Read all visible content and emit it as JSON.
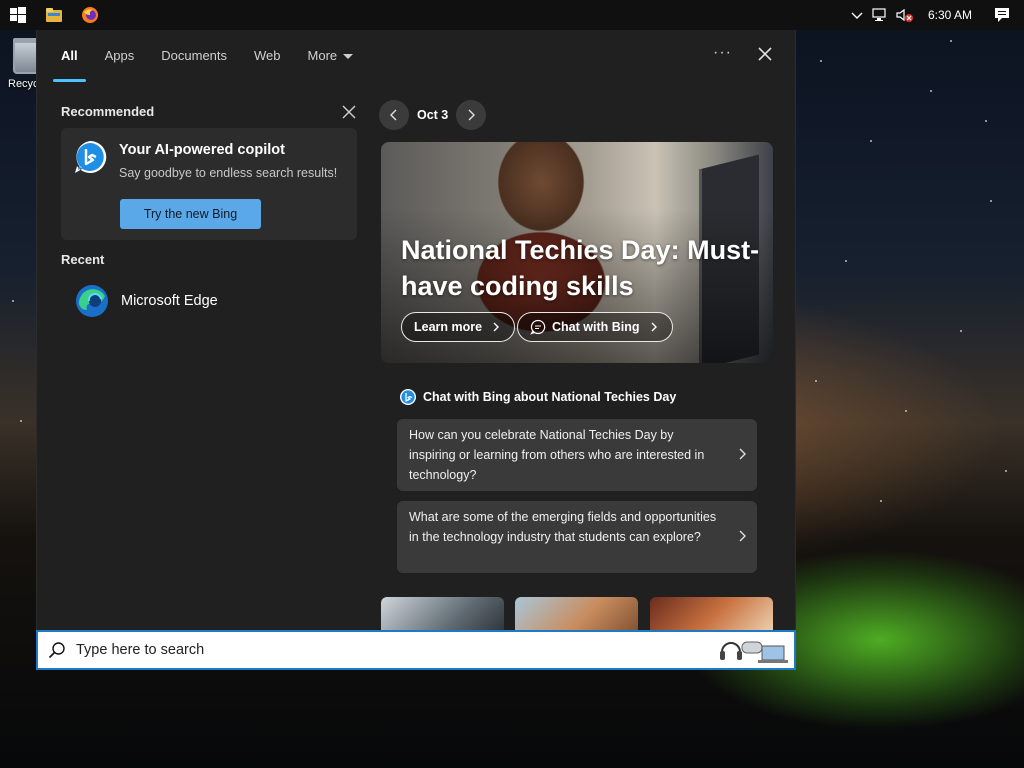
{
  "desktop": {
    "recycle_bin_label": "Recycle Bin"
  },
  "taskbar": {
    "clock": "6:30 AM",
    "icons": [
      "start-icon",
      "file-explorer-icon",
      "firefox-icon"
    ],
    "tray_icons": [
      "chevron-up-icon",
      "network-icon",
      "volume-muted-icon",
      "action-center-icon"
    ]
  },
  "search_panel": {
    "tabs": [
      {
        "label": "All",
        "active": true
      },
      {
        "label": "Apps"
      },
      {
        "label": "Documents"
      },
      {
        "label": "Web"
      },
      {
        "label": "More"
      }
    ],
    "more_options": "···",
    "recommended": {
      "title": "Recommended",
      "card": {
        "title": "Your AI-powered copilot",
        "subtitle": "Say goodbye to endless search results!",
        "button": "Try the new Bing"
      }
    },
    "recent": {
      "title": "Recent",
      "items": [
        {
          "label": "Microsoft Edge",
          "icon": "edge-icon"
        }
      ]
    },
    "highlights": {
      "date": "Oct 3",
      "hero": {
        "headline": "National Techies Day: Must-have coding skills",
        "learn_more": "Learn more",
        "chat_with_bing": "Chat with Bing"
      },
      "chat_header": "Chat with Bing about National Techies Day",
      "questions": [
        "How can you celebrate National Techies Day by inspiring or learning from others who are interested in technology?",
        "What are some of the emerging fields and opportunities in the technology industry that students can explore?"
      ]
    }
  },
  "search_box": {
    "placeholder": "Type here to search"
  },
  "colors": {
    "accent": "#4cc2ff",
    "button": "#5aa8e8",
    "panel": "#202020",
    "card": "#2c2c2c"
  }
}
